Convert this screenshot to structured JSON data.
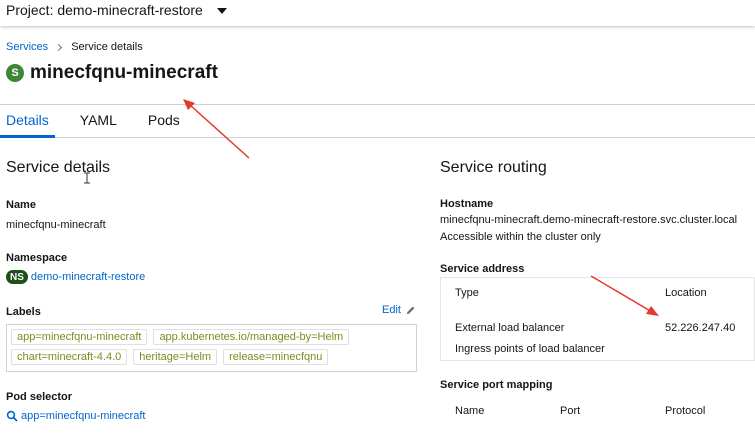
{
  "topbar": {
    "project_label": "Project: demo-minecraft-restore"
  },
  "breadcrumb": {
    "link": "Services",
    "current": "Service details"
  },
  "header": {
    "badge": "S",
    "title": "minecfqnu-minecraft"
  },
  "tabs": [
    {
      "label": "Details"
    },
    {
      "label": "YAML"
    },
    {
      "label": "Pods"
    }
  ],
  "details": {
    "heading": "Service details",
    "name_label": "Name",
    "name_value": "minecfqnu-minecraft",
    "namespace_label": "Namespace",
    "namespace_badge": "NS",
    "namespace_value": "demo-minecraft-restore",
    "labels_label": "Labels",
    "edit_label": "Edit",
    "labels": [
      "app=minecfqnu-minecraft",
      "app.kubernetes.io/managed-by=Helm",
      "chart=minecraft-4.4.0",
      "heritage=Helm",
      "release=minecfqnu"
    ],
    "pod_selector_label": "Pod selector",
    "pod_selector_value": "app=minecfqnu-minecraft"
  },
  "routing": {
    "heading": "Service routing",
    "hostname_label": "Hostname",
    "hostname_value": "minecfqnu-minecraft.demo-minecraft-restore.svc.cluster.local",
    "hostname_note": "Accessible within the cluster only",
    "address_label": "Service address",
    "address_col_type": "Type",
    "address_col_location": "Location",
    "address_type": "External load balancer",
    "address_type_note": "Ingress points of load balancer",
    "address_location": "52.226.247.40",
    "port_mapping_label": "Service port mapping",
    "port_cols": [
      "Name",
      "Port",
      "Protocol"
    ]
  },
  "colors": {
    "accent": "#0066cc",
    "arrow": "#e53a2a",
    "service_badge": "#3e8635",
    "label_chip": "#7a8c1f"
  }
}
